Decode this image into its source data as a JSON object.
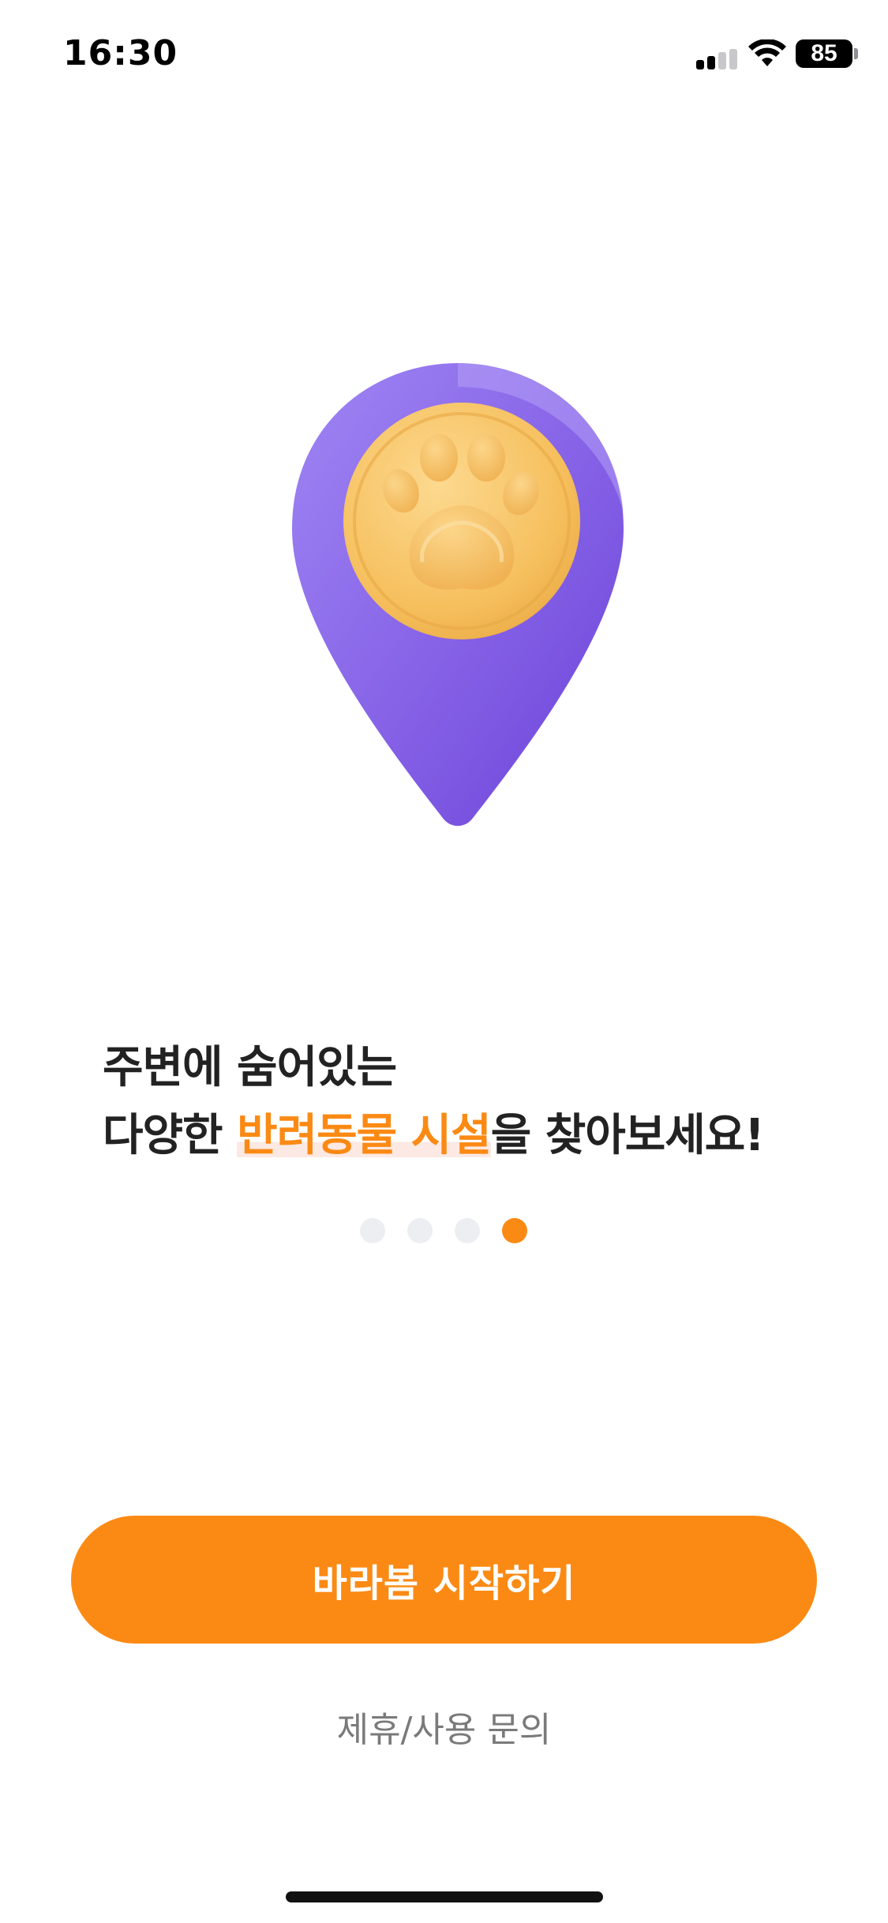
{
  "status_bar": {
    "time": "16:30",
    "battery": "85",
    "icons": [
      "cellular-signal-icon",
      "wifi-icon",
      "battery-icon"
    ]
  },
  "illustration": {
    "icon": "paw-location-pin",
    "colors": {
      "pin": "#8b63e8",
      "coin": "#f7c266",
      "paw": "#f2b957"
    }
  },
  "headline": {
    "line1": "주변에 숨어있는",
    "line2_prefix": "다양한 ",
    "line2_highlight": "반려동물 시설",
    "line2_suffix": "을 찾아보세요!"
  },
  "pager": {
    "total": 4,
    "active_index": 3
  },
  "actions": {
    "start_label": "바라봄 시작하기",
    "inquiry_label": "제휴/사용 문의"
  },
  "colors": {
    "accent": "#fb8a14",
    "highlight_bg": "#fde9e3",
    "dot_inactive": "#eceef2",
    "text_primary": "#222222",
    "text_secondary": "#7a7a7a"
  }
}
